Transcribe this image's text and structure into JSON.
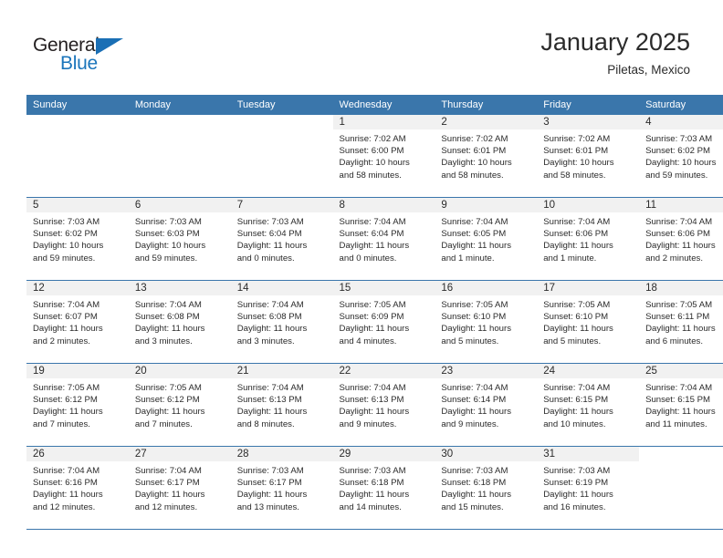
{
  "brand": {
    "name_top": "General",
    "name_bottom": "Blue",
    "triangle_color": "#1a6fb5",
    "blue_color": "#1b75bb"
  },
  "header": {
    "month_title": "January 2025",
    "location": "Piletas, Mexico"
  },
  "theme": {
    "header_row_bg": "#3a76ab",
    "header_row_text": "#ffffff",
    "daynum_band_bg": "#f1f1f1",
    "cell_bg": "#ffffff",
    "grid_line": "#3a76ab",
    "text": "#2b2b2b"
  },
  "weekday_headers": [
    "Sunday",
    "Monday",
    "Tuesday",
    "Wednesday",
    "Thursday",
    "Friday",
    "Saturday"
  ],
  "labels": {
    "sunrise_prefix": "Sunrise:",
    "sunset_prefix": "Sunset:",
    "daylight_prefix": "Daylight:"
  },
  "weeks": [
    [
      {
        "day": "",
        "lines": []
      },
      {
        "day": "",
        "lines": []
      },
      {
        "day": "",
        "lines": []
      },
      {
        "day": "1",
        "lines": [
          "Sunrise: 7:02 AM",
          "Sunset: 6:00 PM",
          "Daylight: 10 hours",
          "and 58 minutes."
        ]
      },
      {
        "day": "2",
        "lines": [
          "Sunrise: 7:02 AM",
          "Sunset: 6:01 PM",
          "Daylight: 10 hours",
          "and 58 minutes."
        ]
      },
      {
        "day": "3",
        "lines": [
          "Sunrise: 7:02 AM",
          "Sunset: 6:01 PM",
          "Daylight: 10 hours",
          "and 58 minutes."
        ]
      },
      {
        "day": "4",
        "lines": [
          "Sunrise: 7:03 AM",
          "Sunset: 6:02 PM",
          "Daylight: 10 hours",
          "and 59 minutes."
        ]
      }
    ],
    [
      {
        "day": "5",
        "lines": [
          "Sunrise: 7:03 AM",
          "Sunset: 6:02 PM",
          "Daylight: 10 hours",
          "and 59 minutes."
        ]
      },
      {
        "day": "6",
        "lines": [
          "Sunrise: 7:03 AM",
          "Sunset: 6:03 PM",
          "Daylight: 10 hours",
          "and 59 minutes."
        ]
      },
      {
        "day": "7",
        "lines": [
          "Sunrise: 7:03 AM",
          "Sunset: 6:04 PM",
          "Daylight: 11 hours",
          "and 0 minutes."
        ]
      },
      {
        "day": "8",
        "lines": [
          "Sunrise: 7:04 AM",
          "Sunset: 6:04 PM",
          "Daylight: 11 hours",
          "and 0 minutes."
        ]
      },
      {
        "day": "9",
        "lines": [
          "Sunrise: 7:04 AM",
          "Sunset: 6:05 PM",
          "Daylight: 11 hours",
          "and 1 minute."
        ]
      },
      {
        "day": "10",
        "lines": [
          "Sunrise: 7:04 AM",
          "Sunset: 6:06 PM",
          "Daylight: 11 hours",
          "and 1 minute."
        ]
      },
      {
        "day": "11",
        "lines": [
          "Sunrise: 7:04 AM",
          "Sunset: 6:06 PM",
          "Daylight: 11 hours",
          "and 2 minutes."
        ]
      }
    ],
    [
      {
        "day": "12",
        "lines": [
          "Sunrise: 7:04 AM",
          "Sunset: 6:07 PM",
          "Daylight: 11 hours",
          "and 2 minutes."
        ]
      },
      {
        "day": "13",
        "lines": [
          "Sunrise: 7:04 AM",
          "Sunset: 6:08 PM",
          "Daylight: 11 hours",
          "and 3 minutes."
        ]
      },
      {
        "day": "14",
        "lines": [
          "Sunrise: 7:04 AM",
          "Sunset: 6:08 PM",
          "Daylight: 11 hours",
          "and 3 minutes."
        ]
      },
      {
        "day": "15",
        "lines": [
          "Sunrise: 7:05 AM",
          "Sunset: 6:09 PM",
          "Daylight: 11 hours",
          "and 4 minutes."
        ]
      },
      {
        "day": "16",
        "lines": [
          "Sunrise: 7:05 AM",
          "Sunset: 6:10 PM",
          "Daylight: 11 hours",
          "and 5 minutes."
        ]
      },
      {
        "day": "17",
        "lines": [
          "Sunrise: 7:05 AM",
          "Sunset: 6:10 PM",
          "Daylight: 11 hours",
          "and 5 minutes."
        ]
      },
      {
        "day": "18",
        "lines": [
          "Sunrise: 7:05 AM",
          "Sunset: 6:11 PM",
          "Daylight: 11 hours",
          "and 6 minutes."
        ]
      }
    ],
    [
      {
        "day": "19",
        "lines": [
          "Sunrise: 7:05 AM",
          "Sunset: 6:12 PM",
          "Daylight: 11 hours",
          "and 7 minutes."
        ]
      },
      {
        "day": "20",
        "lines": [
          "Sunrise: 7:05 AM",
          "Sunset: 6:12 PM",
          "Daylight: 11 hours",
          "and 7 minutes."
        ]
      },
      {
        "day": "21",
        "lines": [
          "Sunrise: 7:04 AM",
          "Sunset: 6:13 PM",
          "Daylight: 11 hours",
          "and 8 minutes."
        ]
      },
      {
        "day": "22",
        "lines": [
          "Sunrise: 7:04 AM",
          "Sunset: 6:13 PM",
          "Daylight: 11 hours",
          "and 9 minutes."
        ]
      },
      {
        "day": "23",
        "lines": [
          "Sunrise: 7:04 AM",
          "Sunset: 6:14 PM",
          "Daylight: 11 hours",
          "and 9 minutes."
        ]
      },
      {
        "day": "24",
        "lines": [
          "Sunrise: 7:04 AM",
          "Sunset: 6:15 PM",
          "Daylight: 11 hours",
          "and 10 minutes."
        ]
      },
      {
        "day": "25",
        "lines": [
          "Sunrise: 7:04 AM",
          "Sunset: 6:15 PM",
          "Daylight: 11 hours",
          "and 11 minutes."
        ]
      }
    ],
    [
      {
        "day": "26",
        "lines": [
          "Sunrise: 7:04 AM",
          "Sunset: 6:16 PM",
          "Daylight: 11 hours",
          "and 12 minutes."
        ]
      },
      {
        "day": "27",
        "lines": [
          "Sunrise: 7:04 AM",
          "Sunset: 6:17 PM",
          "Daylight: 11 hours",
          "and 12 minutes."
        ]
      },
      {
        "day": "28",
        "lines": [
          "Sunrise: 7:03 AM",
          "Sunset: 6:17 PM",
          "Daylight: 11 hours",
          "and 13 minutes."
        ]
      },
      {
        "day": "29",
        "lines": [
          "Sunrise: 7:03 AM",
          "Sunset: 6:18 PM",
          "Daylight: 11 hours",
          "and 14 minutes."
        ]
      },
      {
        "day": "30",
        "lines": [
          "Sunrise: 7:03 AM",
          "Sunset: 6:18 PM",
          "Daylight: 11 hours",
          "and 15 minutes."
        ]
      },
      {
        "day": "31",
        "lines": [
          "Sunrise: 7:03 AM",
          "Sunset: 6:19 PM",
          "Daylight: 11 hours",
          "and 16 minutes."
        ]
      },
      {
        "day": "",
        "lines": []
      }
    ]
  ]
}
